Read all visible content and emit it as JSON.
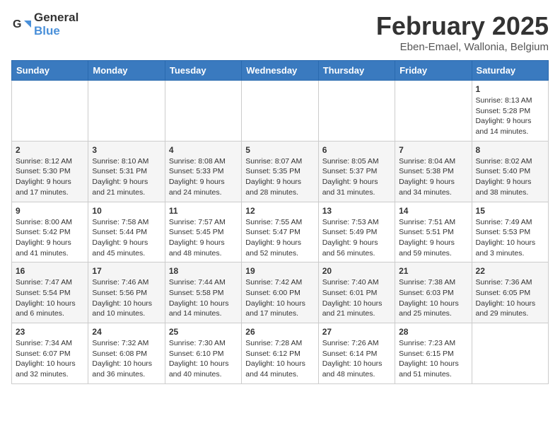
{
  "header": {
    "logo_general": "General",
    "logo_blue": "Blue",
    "month_title": "February 2025",
    "location": "Eben-Emael, Wallonia, Belgium"
  },
  "days_of_week": [
    "Sunday",
    "Monday",
    "Tuesday",
    "Wednesday",
    "Thursday",
    "Friday",
    "Saturday"
  ],
  "weeks": [
    [
      {
        "day": "",
        "info": ""
      },
      {
        "day": "",
        "info": ""
      },
      {
        "day": "",
        "info": ""
      },
      {
        "day": "",
        "info": ""
      },
      {
        "day": "",
        "info": ""
      },
      {
        "day": "",
        "info": ""
      },
      {
        "day": "1",
        "info": "Sunrise: 8:13 AM\nSunset: 5:28 PM\nDaylight: 9 hours and 14 minutes."
      }
    ],
    [
      {
        "day": "2",
        "info": "Sunrise: 8:12 AM\nSunset: 5:30 PM\nDaylight: 9 hours and 17 minutes."
      },
      {
        "day": "3",
        "info": "Sunrise: 8:10 AM\nSunset: 5:31 PM\nDaylight: 9 hours and 21 minutes."
      },
      {
        "day": "4",
        "info": "Sunrise: 8:08 AM\nSunset: 5:33 PM\nDaylight: 9 hours and 24 minutes."
      },
      {
        "day": "5",
        "info": "Sunrise: 8:07 AM\nSunset: 5:35 PM\nDaylight: 9 hours and 28 minutes."
      },
      {
        "day": "6",
        "info": "Sunrise: 8:05 AM\nSunset: 5:37 PM\nDaylight: 9 hours and 31 minutes."
      },
      {
        "day": "7",
        "info": "Sunrise: 8:04 AM\nSunset: 5:38 PM\nDaylight: 9 hours and 34 minutes."
      },
      {
        "day": "8",
        "info": "Sunrise: 8:02 AM\nSunset: 5:40 PM\nDaylight: 9 hours and 38 minutes."
      }
    ],
    [
      {
        "day": "9",
        "info": "Sunrise: 8:00 AM\nSunset: 5:42 PM\nDaylight: 9 hours and 41 minutes."
      },
      {
        "day": "10",
        "info": "Sunrise: 7:58 AM\nSunset: 5:44 PM\nDaylight: 9 hours and 45 minutes."
      },
      {
        "day": "11",
        "info": "Sunrise: 7:57 AM\nSunset: 5:45 PM\nDaylight: 9 hours and 48 minutes."
      },
      {
        "day": "12",
        "info": "Sunrise: 7:55 AM\nSunset: 5:47 PM\nDaylight: 9 hours and 52 minutes."
      },
      {
        "day": "13",
        "info": "Sunrise: 7:53 AM\nSunset: 5:49 PM\nDaylight: 9 hours and 56 minutes."
      },
      {
        "day": "14",
        "info": "Sunrise: 7:51 AM\nSunset: 5:51 PM\nDaylight: 9 hours and 59 minutes."
      },
      {
        "day": "15",
        "info": "Sunrise: 7:49 AM\nSunset: 5:53 PM\nDaylight: 10 hours and 3 minutes."
      }
    ],
    [
      {
        "day": "16",
        "info": "Sunrise: 7:47 AM\nSunset: 5:54 PM\nDaylight: 10 hours and 6 minutes."
      },
      {
        "day": "17",
        "info": "Sunrise: 7:46 AM\nSunset: 5:56 PM\nDaylight: 10 hours and 10 minutes."
      },
      {
        "day": "18",
        "info": "Sunrise: 7:44 AM\nSunset: 5:58 PM\nDaylight: 10 hours and 14 minutes."
      },
      {
        "day": "19",
        "info": "Sunrise: 7:42 AM\nSunset: 6:00 PM\nDaylight: 10 hours and 17 minutes."
      },
      {
        "day": "20",
        "info": "Sunrise: 7:40 AM\nSunset: 6:01 PM\nDaylight: 10 hours and 21 minutes."
      },
      {
        "day": "21",
        "info": "Sunrise: 7:38 AM\nSunset: 6:03 PM\nDaylight: 10 hours and 25 minutes."
      },
      {
        "day": "22",
        "info": "Sunrise: 7:36 AM\nSunset: 6:05 PM\nDaylight: 10 hours and 29 minutes."
      }
    ],
    [
      {
        "day": "23",
        "info": "Sunrise: 7:34 AM\nSunset: 6:07 PM\nDaylight: 10 hours and 32 minutes."
      },
      {
        "day": "24",
        "info": "Sunrise: 7:32 AM\nSunset: 6:08 PM\nDaylight: 10 hours and 36 minutes."
      },
      {
        "day": "25",
        "info": "Sunrise: 7:30 AM\nSunset: 6:10 PM\nDaylight: 10 hours and 40 minutes."
      },
      {
        "day": "26",
        "info": "Sunrise: 7:28 AM\nSunset: 6:12 PM\nDaylight: 10 hours and 44 minutes."
      },
      {
        "day": "27",
        "info": "Sunrise: 7:26 AM\nSunset: 6:14 PM\nDaylight: 10 hours and 48 minutes."
      },
      {
        "day": "28",
        "info": "Sunrise: 7:23 AM\nSunset: 6:15 PM\nDaylight: 10 hours and 51 minutes."
      },
      {
        "day": "",
        "info": ""
      }
    ]
  ]
}
